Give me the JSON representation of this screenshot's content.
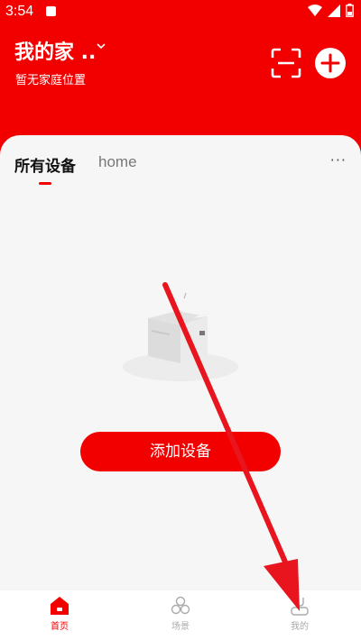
{
  "status_bar": {
    "time": "3:54",
    "app_icon": "notification-app-icon",
    "icons": [
      "wifi-icon",
      "signal-icon",
      "battery-icon"
    ]
  },
  "header": {
    "home_name": "我的家 ..",
    "subtitle": "暂无家庭位置",
    "scan_icon": "scan-icon",
    "add_icon": "plus-icon"
  },
  "tabs": {
    "items": [
      "所有设备",
      "home"
    ],
    "active": "所有设备",
    "more": "···"
  },
  "empty_state": {
    "illustration": "empty-box-icon",
    "button_label": "添加设备"
  },
  "bottom_nav": {
    "items": [
      {
        "label": "首页",
        "icon": "home-icon",
        "active": true
      },
      {
        "label": "场景",
        "icon": "scene-icon",
        "active": false
      },
      {
        "label": "我的",
        "icon": "profile-icon",
        "active": false
      }
    ]
  },
  "colors": {
    "brand": "#f20000",
    "background": "#f6f6f7",
    "inactive": "#aaaaaa",
    "annotation_arrow": "#e8141e"
  }
}
